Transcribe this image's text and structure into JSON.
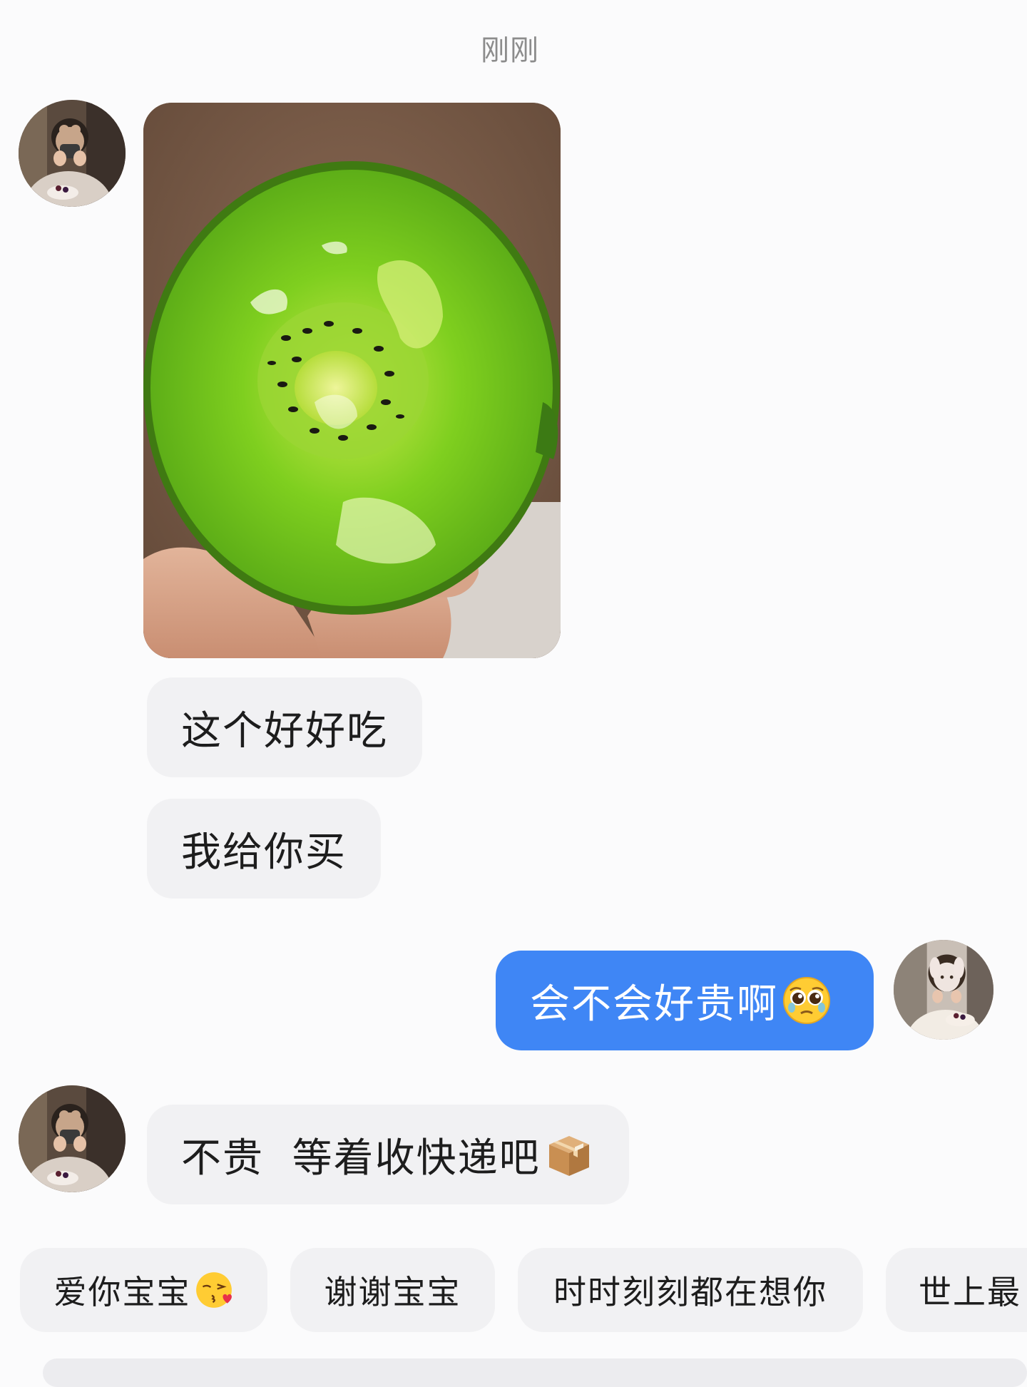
{
  "chat": {
    "timestamp": "刚刚",
    "messages": [
      {
        "sender": "them",
        "type": "image",
        "image_alt": "绿色猕猴桃"
      },
      {
        "sender": "them",
        "type": "text",
        "text": "这个好好吃"
      },
      {
        "sender": "them",
        "type": "text",
        "text": "我给你买"
      },
      {
        "sender": "me",
        "type": "text",
        "text": "会不会好贵啊",
        "emoji": "pleading-face"
      },
      {
        "sender": "them",
        "type": "text",
        "text": "不贵  等着收快递吧",
        "emoji": "package"
      }
    ]
  },
  "quick_replies": [
    {
      "label": "爱你宝宝",
      "emoji": "kissing-heart-face"
    },
    {
      "label": "谢谢宝宝"
    },
    {
      "label": "时时刻刻都在想你"
    },
    {
      "label": "世上最"
    }
  ],
  "colors": {
    "background": "#fbfbfc",
    "incoming_bubble": "#f1f1f3",
    "outgoing_bubble": "#3f86f5",
    "timestamp_text": "#8c8c8c"
  }
}
